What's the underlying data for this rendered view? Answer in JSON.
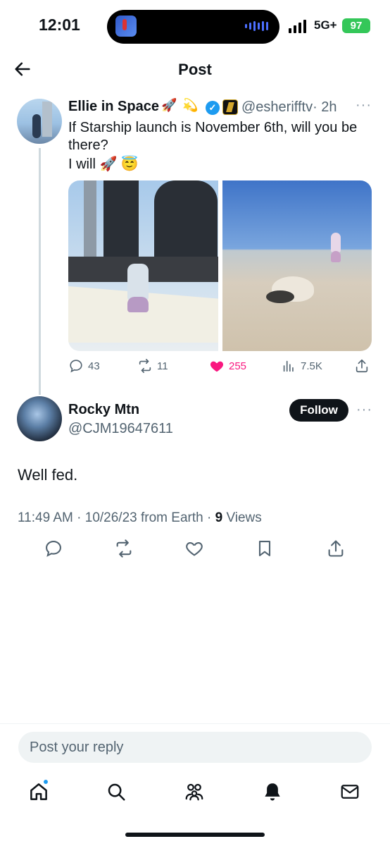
{
  "status_bar": {
    "time": "12:01",
    "network": "5G+",
    "battery": "97"
  },
  "header": {
    "title": "Post"
  },
  "quoted_post": {
    "author_name": "Ellie in Space",
    "name_emojis": [
      "🚀",
      "💫"
    ],
    "handle": "@esherifftv",
    "age": "· 2h",
    "text_line1": "If Starship launch is November 6th, will you be there?",
    "text_line2": "I will",
    "text_emojis": [
      "🚀",
      "😇"
    ],
    "replies": "43",
    "reposts": "11",
    "likes": "255",
    "views": "7.5K"
  },
  "main_post": {
    "author_name": "Rocky Mtn",
    "handle": "@CJM19647611",
    "follow_label": "Follow",
    "text": "Well fed.",
    "timestamp": "11:49 AM · 10/26/23 from Earth ·",
    "view_count": "9",
    "views_label": "Views"
  },
  "reply_bar": {
    "placeholder": "Post your reply"
  },
  "tabs": [
    "home",
    "search",
    "communities",
    "notifications",
    "messages"
  ],
  "colors": {
    "accent": "#1d9bf0",
    "like": "#f91880",
    "text": "#0f1419",
    "secondary": "#536471",
    "battery": "#34c759"
  }
}
